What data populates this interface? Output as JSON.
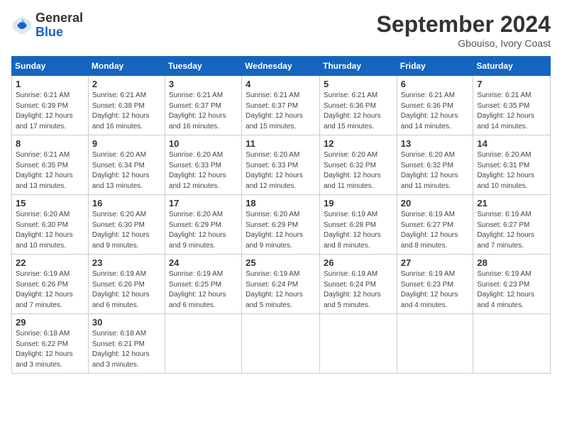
{
  "logo": {
    "general": "General",
    "blue": "Blue"
  },
  "header": {
    "month": "September 2024",
    "location": "Gbouiso, Ivory Coast"
  },
  "weekdays": [
    "Sunday",
    "Monday",
    "Tuesday",
    "Wednesday",
    "Thursday",
    "Friday",
    "Saturday"
  ],
  "weeks": [
    [
      {
        "day": "1",
        "sunrise": "6:21 AM",
        "sunset": "6:39 PM",
        "daylight": "12 hours and 17 minutes."
      },
      {
        "day": "2",
        "sunrise": "6:21 AM",
        "sunset": "6:38 PM",
        "daylight": "12 hours and 16 minutes."
      },
      {
        "day": "3",
        "sunrise": "6:21 AM",
        "sunset": "6:37 PM",
        "daylight": "12 hours and 16 minutes."
      },
      {
        "day": "4",
        "sunrise": "6:21 AM",
        "sunset": "6:37 PM",
        "daylight": "12 hours and 15 minutes."
      },
      {
        "day": "5",
        "sunrise": "6:21 AM",
        "sunset": "6:36 PM",
        "daylight": "12 hours and 15 minutes."
      },
      {
        "day": "6",
        "sunrise": "6:21 AM",
        "sunset": "6:36 PM",
        "daylight": "12 hours and 14 minutes."
      },
      {
        "day": "7",
        "sunrise": "6:21 AM",
        "sunset": "6:35 PM",
        "daylight": "12 hours and 14 minutes."
      }
    ],
    [
      {
        "day": "8",
        "sunrise": "6:21 AM",
        "sunset": "6:35 PM",
        "daylight": "12 hours and 13 minutes."
      },
      {
        "day": "9",
        "sunrise": "6:20 AM",
        "sunset": "6:34 PM",
        "daylight": "12 hours and 13 minutes."
      },
      {
        "day": "10",
        "sunrise": "6:20 AM",
        "sunset": "6:33 PM",
        "daylight": "12 hours and 12 minutes."
      },
      {
        "day": "11",
        "sunrise": "6:20 AM",
        "sunset": "6:33 PM",
        "daylight": "12 hours and 12 minutes."
      },
      {
        "day": "12",
        "sunrise": "6:20 AM",
        "sunset": "6:32 PM",
        "daylight": "12 hours and 11 minutes."
      },
      {
        "day": "13",
        "sunrise": "6:20 AM",
        "sunset": "6:32 PM",
        "daylight": "12 hours and 11 minutes."
      },
      {
        "day": "14",
        "sunrise": "6:20 AM",
        "sunset": "6:31 PM",
        "daylight": "12 hours and 10 minutes."
      }
    ],
    [
      {
        "day": "15",
        "sunrise": "6:20 AM",
        "sunset": "6:30 PM",
        "daylight": "12 hours and 10 minutes."
      },
      {
        "day": "16",
        "sunrise": "6:20 AM",
        "sunset": "6:30 PM",
        "daylight": "12 hours and 9 minutes."
      },
      {
        "day": "17",
        "sunrise": "6:20 AM",
        "sunset": "6:29 PM",
        "daylight": "12 hours and 9 minutes."
      },
      {
        "day": "18",
        "sunrise": "6:20 AM",
        "sunset": "6:29 PM",
        "daylight": "12 hours and 9 minutes."
      },
      {
        "day": "19",
        "sunrise": "6:19 AM",
        "sunset": "6:28 PM",
        "daylight": "12 hours and 8 minutes."
      },
      {
        "day": "20",
        "sunrise": "6:19 AM",
        "sunset": "6:27 PM",
        "daylight": "12 hours and 8 minutes."
      },
      {
        "day": "21",
        "sunrise": "6:19 AM",
        "sunset": "6:27 PM",
        "daylight": "12 hours and 7 minutes."
      }
    ],
    [
      {
        "day": "22",
        "sunrise": "6:19 AM",
        "sunset": "6:26 PM",
        "daylight": "12 hours and 7 minutes."
      },
      {
        "day": "23",
        "sunrise": "6:19 AM",
        "sunset": "6:26 PM",
        "daylight": "12 hours and 6 minutes."
      },
      {
        "day": "24",
        "sunrise": "6:19 AM",
        "sunset": "6:25 PM",
        "daylight": "12 hours and 6 minutes."
      },
      {
        "day": "25",
        "sunrise": "6:19 AM",
        "sunset": "6:24 PM",
        "daylight": "12 hours and 5 minutes."
      },
      {
        "day": "26",
        "sunrise": "6:19 AM",
        "sunset": "6:24 PM",
        "daylight": "12 hours and 5 minutes."
      },
      {
        "day": "27",
        "sunrise": "6:19 AM",
        "sunset": "6:23 PM",
        "daylight": "12 hours and 4 minutes."
      },
      {
        "day": "28",
        "sunrise": "6:19 AM",
        "sunset": "6:23 PM",
        "daylight": "12 hours and 4 minutes."
      }
    ],
    [
      {
        "day": "29",
        "sunrise": "6:18 AM",
        "sunset": "6:22 PM",
        "daylight": "12 hours and 3 minutes."
      },
      {
        "day": "30",
        "sunrise": "6:18 AM",
        "sunset": "6:21 PM",
        "daylight": "12 hours and 3 minutes."
      },
      null,
      null,
      null,
      null,
      null
    ]
  ]
}
